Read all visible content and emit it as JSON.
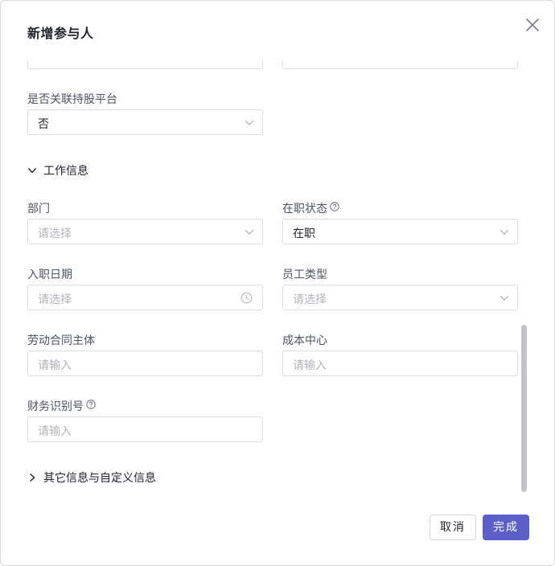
{
  "dialog": {
    "title": "新增参与人",
    "close_icon": "close-icon",
    "cancel_label": "取消",
    "ok_label": "完成",
    "accent_color": "#5b5fc7"
  },
  "form": {
    "link_platform": {
      "label": "是否关联持股平台",
      "value": "否"
    },
    "work_section": {
      "label": "工作信息",
      "expanded": true
    },
    "department": {
      "label": "部门",
      "placeholder": "请选择"
    },
    "employment_status": {
      "label": "在职状态",
      "value": "在职"
    },
    "hire_date": {
      "label": "入职日期",
      "placeholder": "请选择"
    },
    "employee_type": {
      "label": "员工类型",
      "placeholder": "请选择"
    },
    "labor_contract_entity": {
      "label": "劳动合同主体",
      "placeholder": "请输入"
    },
    "cost_center": {
      "label": "成本中心",
      "placeholder": "请输入"
    },
    "finance_id": {
      "label": "财务识别号",
      "placeholder": "请输入"
    },
    "other_section": {
      "label": "其它信息与自定义信息",
      "expanded": false
    }
  }
}
